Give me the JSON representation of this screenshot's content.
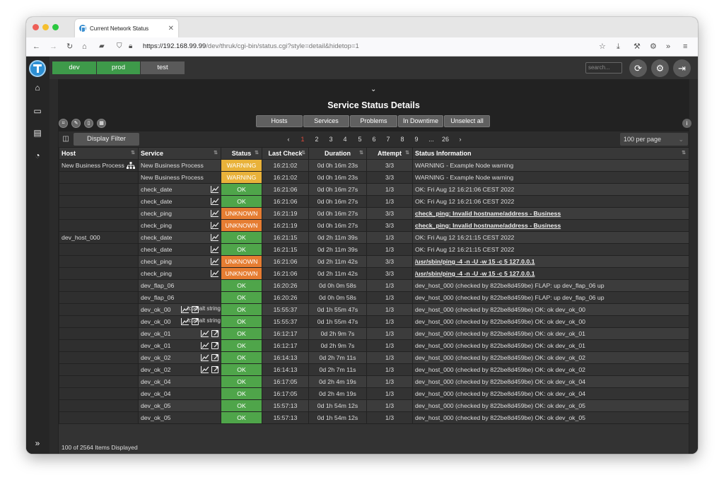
{
  "browser": {
    "tab_title": "Current Network Status",
    "url_host": "https://192.168.99.99",
    "url_path": "/dev/thruk/cgi-bin/status.cgi?style=detail&hidetop=1"
  },
  "topbar": {
    "envs": [
      {
        "label": "dev",
        "color": "#3e9a4a"
      },
      {
        "label": "prod",
        "color": "#3e9a4a"
      },
      {
        "label": "test",
        "color": "#5a5a5a"
      }
    ],
    "search_placeholder": "search..."
  },
  "page": {
    "title": "Service Status Details",
    "filter_buttons": [
      "Hosts",
      "Services",
      "Problems",
      "In Downtime",
      "Unselect all"
    ],
    "display_filter": "Display Filter",
    "pages": [
      "‹",
      "1",
      "2",
      "3",
      "4",
      "5",
      "6",
      "7",
      "8",
      "9",
      "...",
      "26",
      "›"
    ],
    "current_page": "1",
    "per_page": "100 per page",
    "footer": "100 of 2564 Items Displayed"
  },
  "colors": {
    "ok": "#4fa54a",
    "warning": "#e9b23a",
    "unknown": "#e67d32"
  },
  "table": {
    "headers": [
      "Host",
      "Service",
      "Status",
      "Last Check",
      "Duration",
      "Attempt",
      "Status Information"
    ],
    "rows": [
      {
        "host": "New Business Process",
        "service": "New Business Process",
        "status": "WARNING",
        "last": "16:21:02",
        "dur": "0d 0h 16m 23s",
        "att": "3/3",
        "info": "WARNING - Example Node warning",
        "graph": false,
        "link": false
      },
      {
        "host": "",
        "service": "New Business Process",
        "status": "WARNING",
        "last": "16:21:02",
        "dur": "0d 0h 16m 23s",
        "att": "3/3",
        "info": "WARNING - Example Node warning",
        "graph": false,
        "link": false
      },
      {
        "host": "",
        "service": "check_date",
        "status": "OK",
        "last": "16:21:06",
        "dur": "0d 0h 16m 27s",
        "att": "1/3",
        "info": "OK: Fri Aug 12 16:21:06 CEST 2022",
        "graph": true,
        "link": false
      },
      {
        "host": "",
        "service": "check_date",
        "status": "OK",
        "last": "16:21:06",
        "dur": "0d 0h 16m 27s",
        "att": "1/3",
        "info": "OK: Fri Aug 12 16:21:06 CEST 2022",
        "graph": true,
        "link": false
      },
      {
        "host": "",
        "service": "check_ping",
        "status": "UNKNOWN",
        "last": "16:21:19",
        "dur": "0d 0h 16m 27s",
        "att": "3/3",
        "info": "check_ping: Invalid hostname/address - Business",
        "graph": true,
        "link": false,
        "bold": true
      },
      {
        "host": "",
        "service": "check_ping",
        "status": "UNKNOWN",
        "last": "16:21:19",
        "dur": "0d 0h 16m 27s",
        "att": "3/3",
        "info": "check_ping: Invalid hostname/address - Business",
        "graph": true,
        "link": false,
        "bold": true
      },
      {
        "host": "dev_host_000",
        "service": "check_date",
        "status": "OK",
        "last": "16:21:15",
        "dur": "0d 2h 11m 39s",
        "att": "1/3",
        "info": "OK: Fri Aug 12 16:21:15 CEST 2022",
        "graph": true,
        "link": false
      },
      {
        "host": "",
        "service": "check_date",
        "status": "OK",
        "last": "16:21:15",
        "dur": "0d 2h 11m 39s",
        "att": "1/3",
        "info": "OK: Fri Aug 12 16:21:15 CEST 2022",
        "graph": true,
        "link": false
      },
      {
        "host": "",
        "service": "check_ping",
        "status": "UNKNOWN",
        "last": "16:21:06",
        "dur": "0d 2h 11m 42s",
        "att": "3/3",
        "info": "/usr/sbin/ping -4 -n -U -w 15 -c 5 127.0.0.1",
        "graph": true,
        "link": false,
        "bold": true
      },
      {
        "host": "",
        "service": "check_ping",
        "status": "UNKNOWN",
        "last": "16:21:06",
        "dur": "0d 2h 11m 42s",
        "att": "3/3",
        "info": "/usr/sbin/ping -4 -n -U -w 15 -c 5 127.0.0.1",
        "graph": true,
        "link": false,
        "bold": true
      },
      {
        "host": "",
        "service": "dev_flap_06",
        "status": "OK",
        "last": "16:20:26",
        "dur": "0d 0h 0m 58s",
        "att": "1/3",
        "info": "dev_host_000 (checked by 822be8d459be) FLAP: up dev_flap_06 up",
        "graph": false,
        "link": false
      },
      {
        "host": "",
        "service": "dev_flap_06",
        "status": "OK",
        "last": "16:20:26",
        "dur": "0d 0h 0m 58s",
        "att": "1/3",
        "info": "dev_host_000 (checked by 822be8d459be) FLAP: up dev_flap_06 up",
        "graph": false,
        "link": false
      },
      {
        "host": "",
        "service": "dev_ok_00",
        "status": "OK",
        "last": "15:55:37",
        "dur": "0d 1h 55m 47s",
        "att": "1/3",
        "info": "dev_host_000 (checked by 822be8d459be) OK: ok dev_ok_00",
        "graph": true,
        "link": true,
        "alt": "icon alt string"
      },
      {
        "host": "",
        "service": "dev_ok_00",
        "status": "OK",
        "last": "15:55:37",
        "dur": "0d 1h 55m 47s",
        "att": "1/3",
        "info": "dev_host_000 (checked by 822be8d459be) OK: ok dev_ok_00",
        "graph": true,
        "link": true,
        "alt": "icon alt string"
      },
      {
        "host": "",
        "service": "dev_ok_01",
        "status": "OK",
        "last": "16:12:17",
        "dur": "0d 2h 9m 7s",
        "att": "1/3",
        "info": "dev_host_000 (checked by 822be8d459be) OK: ok dev_ok_01",
        "graph": true,
        "link": true
      },
      {
        "host": "",
        "service": "dev_ok_01",
        "status": "OK",
        "last": "16:12:17",
        "dur": "0d 2h 9m 7s",
        "att": "1/3",
        "info": "dev_host_000 (checked by 822be8d459be) OK: ok dev_ok_01",
        "graph": true,
        "link": true
      },
      {
        "host": "",
        "service": "dev_ok_02",
        "status": "OK",
        "last": "16:14:13",
        "dur": "0d 2h 7m 11s",
        "att": "1/3",
        "info": "dev_host_000 (checked by 822be8d459be) OK: ok dev_ok_02",
        "graph": true,
        "link": true
      },
      {
        "host": "",
        "service": "dev_ok_02",
        "status": "OK",
        "last": "16:14:13",
        "dur": "0d 2h 7m 11s",
        "att": "1/3",
        "info": "dev_host_000 (checked by 822be8d459be) OK: ok dev_ok_02",
        "graph": true,
        "link": true
      },
      {
        "host": "",
        "service": "dev_ok_04",
        "status": "OK",
        "last": "16:17:05",
        "dur": "0d 2h 4m 19s",
        "att": "1/3",
        "info": "dev_host_000 (checked by 822be8d459be) OK: ok dev_ok_04",
        "graph": false,
        "link": false
      },
      {
        "host": "",
        "service": "dev_ok_04",
        "status": "OK",
        "last": "16:17:05",
        "dur": "0d 2h 4m 19s",
        "att": "1/3",
        "info": "dev_host_000 (checked by 822be8d459be) OK: ok dev_ok_04",
        "graph": false,
        "link": false
      },
      {
        "host": "",
        "service": "dev_ok_05",
        "status": "OK",
        "last": "15:57:13",
        "dur": "0d 1h 54m 12s",
        "att": "1/3",
        "info": "dev_host_000 (checked by 822be8d459be) OK: ok dev_ok_05",
        "graph": false,
        "link": false
      },
      {
        "host": "",
        "service": "dev_ok_05",
        "status": "OK",
        "last": "15:57:13",
        "dur": "0d 1h 54m 12s",
        "att": "1/3",
        "info": "dev_host_000 (checked by 822be8d459be) OK: ok dev_ok_05",
        "graph": false,
        "link": false
      }
    ]
  }
}
